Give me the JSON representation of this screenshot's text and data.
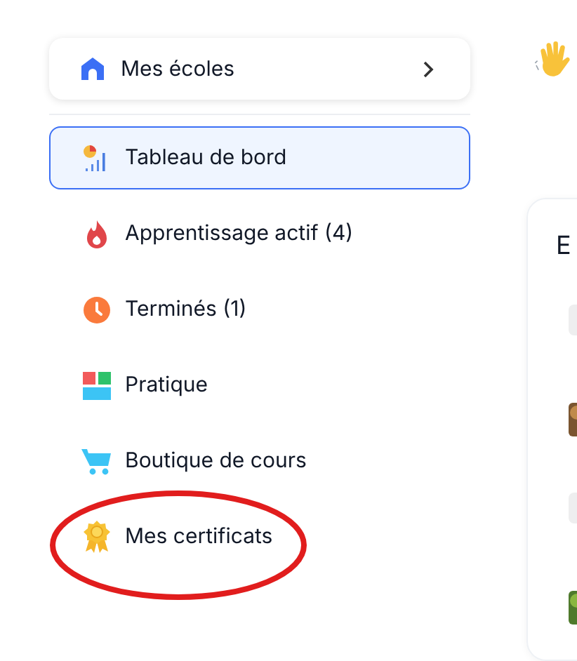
{
  "schools_button": {
    "label": "Mes écoles"
  },
  "nav_items": [
    {
      "label": "Tableau de bord",
      "selected": true,
      "highlighted": false
    },
    {
      "label": "Apprentissage actif (4)",
      "selected": false,
      "highlighted": false
    },
    {
      "label": "Terminés (1)",
      "selected": false,
      "highlighted": false
    },
    {
      "label": "Pratique",
      "selected": false,
      "highlighted": false
    },
    {
      "label": "Boutique de cours",
      "selected": false,
      "highlighted": false
    },
    {
      "label": "Mes certificats",
      "selected": false,
      "highlighted": true
    }
  ],
  "card": {
    "title": "E",
    "items": [
      {
        "kind": "tag"
      },
      {
        "kind": "picture"
      },
      {
        "kind": "tag"
      },
      {
        "kind": "picture"
      }
    ]
  }
}
